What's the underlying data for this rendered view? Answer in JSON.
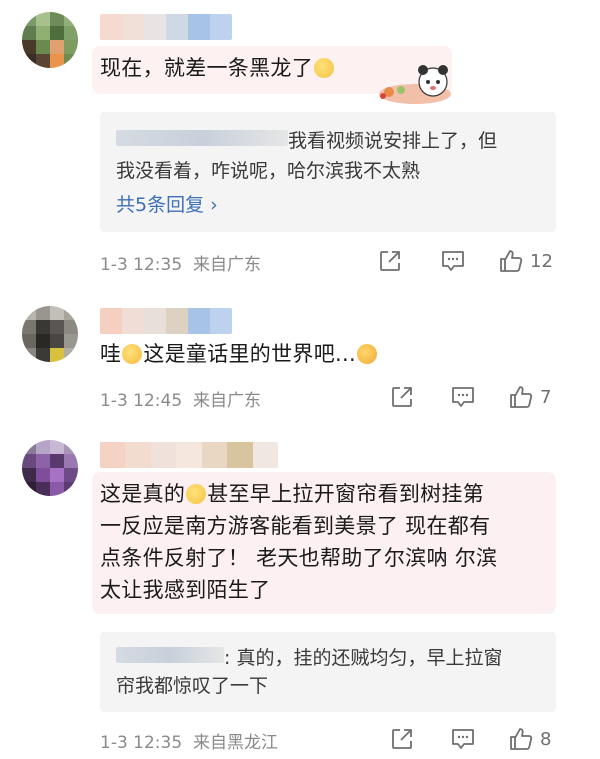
{
  "comments": [
    {
      "text_before_emoji": "现在，就差一条黑龙了",
      "reply": {
        "text": "我看视频说安排上了，但我没看着，咋说呢，哈尔滨我不太熟",
        "line1": "我看视频说安排上了，但",
        "line2": "我没看着，咋说呢，哈尔滨我不太熟",
        "more": "共5条回复 ›"
      },
      "time": "1-3 12:35",
      "location": "来自广东",
      "likes": "12"
    },
    {
      "text_before_emoji": "哇",
      "text_after_emoji": "这是童话里的世界吧...",
      "time": "1-3 12:45",
      "location": "来自广东",
      "likes": "7"
    },
    {
      "line1_a": "这是真的",
      "line1_b": "甚至早上拉开窗帘看到树挂第",
      "line2": "一反应是南方游客能看到美景了 现在都有",
      "line3": "点条件反射了！ 老天也帮助了尔滨呐 尔滨",
      "line4": "太让我感到陌生了",
      "reply": {
        "line1": ": 真的，挂的还贼均匀，早上拉窗",
        "line2": "帘我都惊叹了一下"
      },
      "time": "1-3 12:35",
      "location": "来自黑龙江",
      "likes": "8"
    }
  ],
  "icons": {
    "share": "share-icon",
    "comment": "comment-icon",
    "like": "thumbs-up-icon"
  },
  "colors": {
    "link": "#3f6fb6",
    "meta": "#8a8a8a",
    "reply_bg": "#f4f4f4"
  }
}
